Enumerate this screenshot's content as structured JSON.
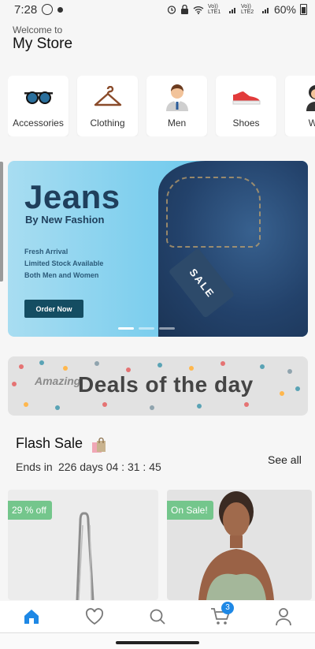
{
  "status": {
    "time": "7:28",
    "battery": "60%",
    "sim1": "Vo)) LTE1",
    "sim2": "Vo)) LTE2"
  },
  "header": {
    "welcome": "Welcome to",
    "store": "My Store"
  },
  "categories": [
    {
      "label": "Accessories",
      "icon": "sunglasses-icon"
    },
    {
      "label": "Clothing",
      "icon": "hanger-icon"
    },
    {
      "label": "Men",
      "icon": "man-icon"
    },
    {
      "label": "Shoes",
      "icon": "shoe-icon"
    },
    {
      "label": "Wo",
      "icon": "woman-icon"
    }
  ],
  "banner": {
    "title": "Jeans",
    "subtitle": "By New Fashion",
    "lines": [
      "Fresh Arrival",
      "Limited Stock Available",
      "Both Men and Women"
    ],
    "button": "Order Now",
    "tag": "SALE",
    "slide_index": 1,
    "slide_count": 3
  },
  "deals": {
    "amazing": "Amazing",
    "title": "Deals of the day"
  },
  "flash": {
    "title": "Flash Sale",
    "ends_label": "Ends in",
    "timer": "226 days 04 : 31 : 45",
    "see_all": "See all"
  },
  "products": [
    {
      "badge": "29 % off"
    },
    {
      "badge": "On Sale!"
    }
  ],
  "nav": {
    "cart_count": "3",
    "active": "home",
    "items": [
      "home-icon",
      "heart-icon",
      "search-icon",
      "cart-icon",
      "user-icon"
    ]
  }
}
